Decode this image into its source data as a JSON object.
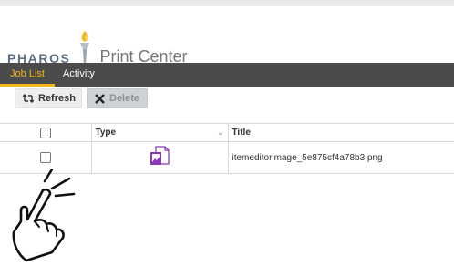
{
  "app": {
    "brand": "PHAROS",
    "product": "Print Center"
  },
  "tabs": [
    {
      "label": "Job List",
      "active": true
    },
    {
      "label": "Activity",
      "active": false
    }
  ],
  "toolbar": {
    "refresh_label": "Refresh",
    "delete_label": "Delete"
  },
  "table": {
    "columns": [
      "",
      "Type",
      "Title"
    ],
    "rows": [
      {
        "checked": false,
        "type_icon": "image-file-icon",
        "title": "itemeditorimage_5e875cf4a78b3.png"
      }
    ]
  },
  "colors": {
    "nav_bg": "#4b4b4b",
    "active_tab": "#f6b51c",
    "file_icon": "#8a3ab9"
  },
  "overlay": {
    "icon": "pointing-hand-tap-icon"
  }
}
